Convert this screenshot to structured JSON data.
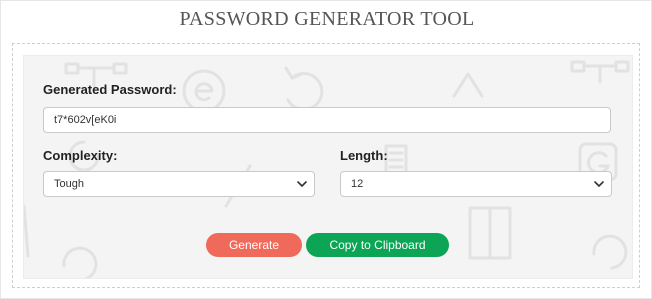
{
  "header": {
    "title": "PASSWORD GENERATOR TOOL"
  },
  "form": {
    "password_label": "Generated Password:",
    "password_value": "t7*602v[eK0i",
    "complexity_label": "Complexity:",
    "complexity_value": "Tough",
    "length_label": "Length:",
    "length_value": "12"
  },
  "buttons": {
    "generate_label": "Generate",
    "copy_label": "Copy to Clipboard"
  },
  "colors": {
    "generate": "#ef6a5a",
    "copy": "#0ba555"
  },
  "icons": {
    "select_arrow": "chevron-down-icon"
  }
}
